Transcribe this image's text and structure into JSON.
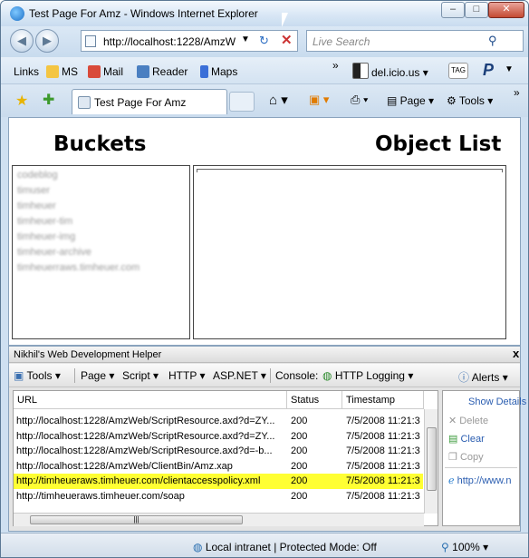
{
  "window": {
    "title": "Test Page For Amz - Windows Internet Explorer",
    "min_label": "–",
    "max_label": "□",
    "close_label": "✕"
  },
  "nav": {
    "back_label": "◀",
    "forward_label": "▶",
    "address": "http://localhost:1228/AmzW",
    "dropdown": "▼",
    "refresh": "↻",
    "stop": "✕",
    "search_placeholder": "Live Search",
    "search_icon": "⚲"
  },
  "links": {
    "label": "Links",
    "items": [
      "MS",
      "Mail",
      "Reader",
      "Maps"
    ],
    "chevron": "»",
    "delicious": "del.icio.us",
    "tag": "TAG"
  },
  "tabs": {
    "active": "Test Page For Amz",
    "page_menu": "Page",
    "tools_menu": "Tools",
    "chevron": "»"
  },
  "page": {
    "buckets_heading": "Buckets",
    "object_list_heading": "Object List",
    "buckets": [
      "codeblog",
      "timuser",
      "timheuer",
      "timheuer-tim",
      "timheuer-img",
      "timheuer-archive",
      "timheuerraws.timheuer.com"
    ]
  },
  "helper": {
    "title": "Nikhil's Web Development Helper",
    "close": "x",
    "toolbar": {
      "tools": "Tools",
      "page": "Page",
      "script": "Script",
      "http": "HTTP",
      "aspnet": "ASP.NET",
      "console": "Console:",
      "http_logging": "HTTP Logging",
      "alerts": "Alerts"
    },
    "columns": [
      "URL",
      "Status",
      "Timestamp"
    ],
    "rows": [
      {
        "url": "http://localhost:1228/AmzWeb/ScriptResource.axd?d=ZY...",
        "status": "200",
        "ts": "7/5/2008 11:21:3",
        "highlight": false
      },
      {
        "url": "http://localhost:1228/AmzWeb/ScriptResource.axd?d=ZY...",
        "status": "200",
        "ts": "7/5/2008 11:21:3",
        "highlight": false
      },
      {
        "url": "http://localhost:1228/AmzWeb/ScriptResource.axd?d=-b...",
        "status": "200",
        "ts": "7/5/2008 11:21:3",
        "highlight": false
      },
      {
        "url": "http://localhost:1228/AmzWeb/ClientBin/Amz.xap",
        "status": "200",
        "ts": "7/5/2008 11:21:3",
        "highlight": false
      },
      {
        "url": "http://timheueraws.timheuer.com/clientaccesspolicy.xml",
        "status": "200",
        "ts": "7/5/2008 11:21:3",
        "highlight": true
      },
      {
        "url": "http://timheueraws.timheuer.com/soap",
        "status": "200",
        "ts": "7/5/2008 11:21:3",
        "highlight": false
      }
    ],
    "side": {
      "show_details": "Show Details",
      "delete": "Delete",
      "clear": "Clear",
      "copy": "Copy",
      "link": "http://www.n"
    }
  },
  "status": {
    "zone": "Local intranet | Protected Mode: Off",
    "zoom": "100%"
  }
}
